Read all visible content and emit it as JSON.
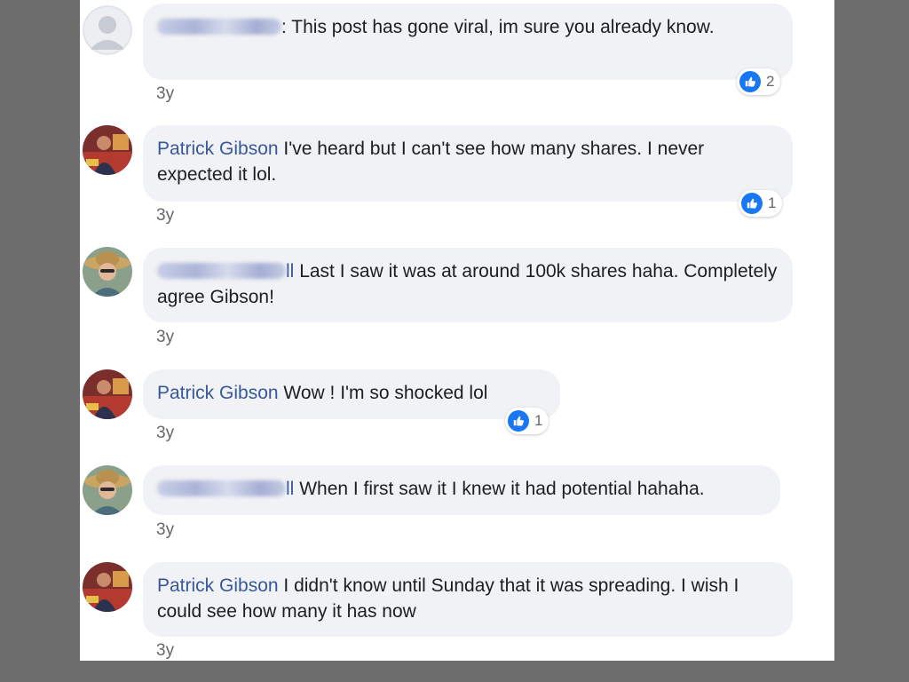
{
  "comments": [
    {
      "author": "",
      "author_tail": "",
      "author_blurred": true,
      "text": "This post has gone viral, im sure you already know.",
      "time": "3y",
      "reaction_count": "2",
      "avatar": "default-avatar"
    },
    {
      "author": "Patrick Gibson",
      "author_blurred": false,
      "text": "I've heard but I can't see how many shares. I never expected it lol.",
      "time": "3y",
      "reaction_count": "1",
      "avatar": "patrick-avatar"
    },
    {
      "author": "",
      "author_tail": "ll",
      "author_blurred": true,
      "text": "Last I saw it was at around 100k shares haha. Completely agree Gibson!",
      "time": "3y",
      "avatar": "hat-avatar"
    },
    {
      "author": "Patrick Gibson",
      "author_blurred": false,
      "text": "Wow ! I'm so shocked lol",
      "time": "3y",
      "reaction_count": "1",
      "avatar": "patrick-avatar"
    },
    {
      "author": "",
      "author_tail": "ll",
      "author_blurred": true,
      "text": "When I first saw it I knew it had potential hahaha.",
      "time": "3y",
      "avatar": "hat-avatar"
    },
    {
      "author": "Patrick Gibson",
      "author_blurred": false,
      "text": "I didn't know until Sunday that it was spreading. I wish I could see how many it has now",
      "time": "3y",
      "avatar": "patrick-avatar"
    }
  ],
  "colors": {
    "author_link": "#385898",
    "bubble_bg": "#f0f2f5",
    "like_blue": "#1877f2",
    "outer_bg": "#6d6d6d"
  }
}
